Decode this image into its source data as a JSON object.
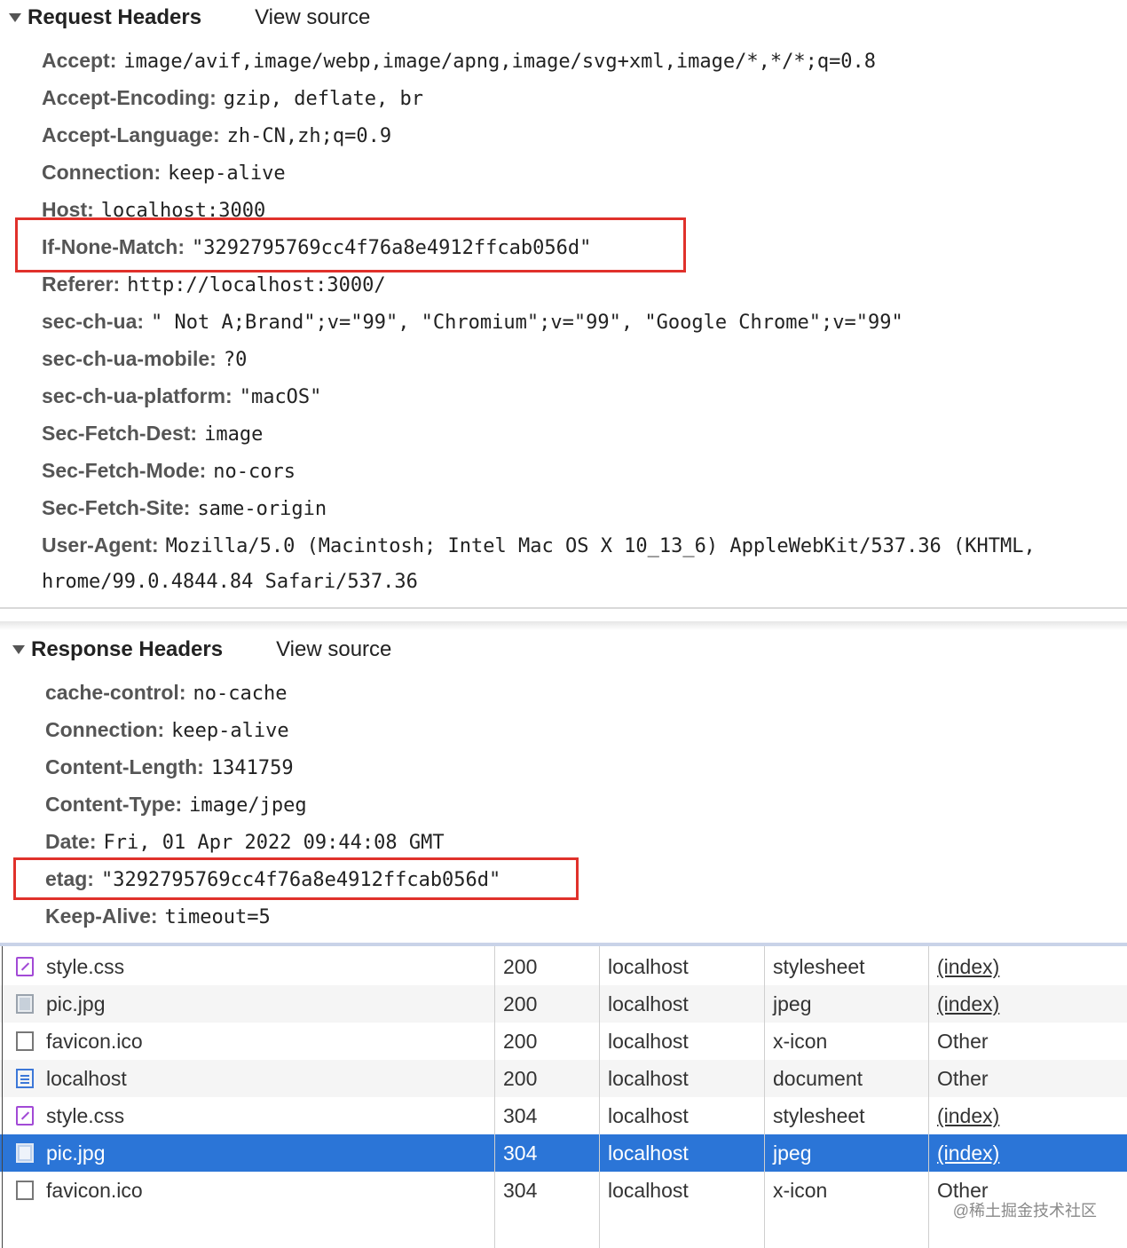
{
  "request": {
    "title": "Request Headers",
    "view_source": "View source",
    "headers": [
      {
        "name": "Accept:",
        "value": "image/avif,image/webp,image/apng,image/svg+xml,image/*,*/*;q=0.8"
      },
      {
        "name": "Accept-Encoding:",
        "value": "gzip, deflate, br"
      },
      {
        "name": "Accept-Language:",
        "value": "zh-CN,zh;q=0.9"
      },
      {
        "name": "Connection:",
        "value": "keep-alive"
      },
      {
        "name": "Host:",
        "value": "localhost:3000"
      },
      {
        "name": "If-None-Match:",
        "value": "\"3292795769cc4f76a8e4912ffcab056d\""
      },
      {
        "name": "Referer:",
        "value": "http://localhost:3000/"
      },
      {
        "name": "sec-ch-ua:",
        "value": "\" Not A;Brand\";v=\"99\", \"Chromium\";v=\"99\", \"Google Chrome\";v=\"99\""
      },
      {
        "name": "sec-ch-ua-mobile:",
        "value": "?0"
      },
      {
        "name": "sec-ch-ua-platform:",
        "value": "\"macOS\""
      },
      {
        "name": "Sec-Fetch-Dest:",
        "value": "image"
      },
      {
        "name": "Sec-Fetch-Mode:",
        "value": "no-cors"
      },
      {
        "name": "Sec-Fetch-Site:",
        "value": "same-origin"
      },
      {
        "name": "User-Agent:",
        "value": "Mozilla/5.0 (Macintosh; Intel Mac OS X 10_13_6) AppleWebKit/537.36 (KHTML,"
      }
    ],
    "user_agent_cont": "hrome/99.0.4844.84 Safari/537.36"
  },
  "response": {
    "title": "Response Headers",
    "view_source": "View source",
    "headers": [
      {
        "name": "cache-control:",
        "value": "no-cache"
      },
      {
        "name": "Connection:",
        "value": "keep-alive"
      },
      {
        "name": "Content-Length:",
        "value": "1341759"
      },
      {
        "name": "Content-Type:",
        "value": "image/jpeg"
      },
      {
        "name": "Date:",
        "value": "Fri, 01 Apr 2022 09:44:08 GMT"
      },
      {
        "name": "etag:",
        "value": "\"3292795769cc4f76a8e4912ffcab056d\""
      },
      {
        "name": "Keep-Alive:",
        "value": "timeout=5"
      }
    ]
  },
  "network": {
    "rows": [
      {
        "name": "style.css",
        "icon": "css-file-icon",
        "status": "200",
        "domain": "localhost",
        "type": "stylesheet",
        "initiator": "(index)"
      },
      {
        "name": "pic.jpg",
        "icon": "image-file-icon",
        "status": "200",
        "domain": "localhost",
        "type": "jpeg",
        "initiator": "(index)"
      },
      {
        "name": "favicon.ico",
        "icon": "blank-file-icon",
        "status": "200",
        "domain": "localhost",
        "type": "x-icon",
        "initiator": "Other"
      },
      {
        "name": "localhost",
        "icon": "document-icon",
        "status": "200",
        "domain": "localhost",
        "type": "document",
        "initiator": "Other"
      },
      {
        "name": "style.css",
        "icon": "css-file-icon",
        "status": "304",
        "domain": "localhost",
        "type": "stylesheet",
        "initiator": "(index)"
      },
      {
        "name": "pic.jpg",
        "icon": "image-file-icon",
        "status": "304",
        "domain": "localhost",
        "type": "jpeg",
        "initiator": "(index)"
      },
      {
        "name": "favicon.ico",
        "icon": "blank-file-icon",
        "status": "304",
        "domain": "localhost",
        "type": "x-icon",
        "initiator": "Other"
      }
    ],
    "selected_row": 5
  },
  "watermark": "@稀土掘金技术社区",
  "colors": {
    "highlight": "#e0312b",
    "selection": "#2b75d7"
  }
}
